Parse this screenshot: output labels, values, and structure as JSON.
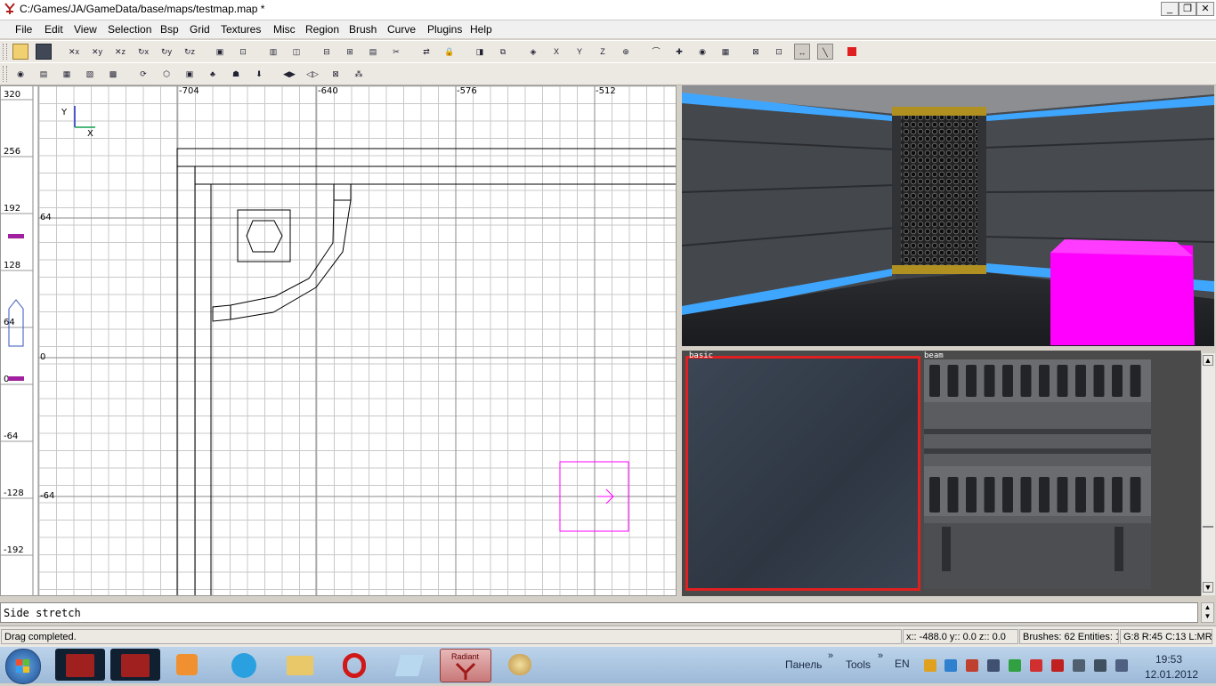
{
  "window": {
    "title": "C:/Games/JA/GameData/base/maps/testmap.map *",
    "minimize_glyph": "_",
    "maximize_glyph": "❐",
    "close_glyph": "✕"
  },
  "menu": [
    "File",
    "Edit",
    "View",
    "Selection",
    "Bsp",
    "Grid",
    "Textures",
    "Misc",
    "Region",
    "Brush",
    "Curve",
    "Plugins",
    "Help"
  ],
  "toolbar1_icons": [
    "open-icon",
    "save-icon",
    "flip-x-icon",
    "flip-y-icon",
    "flip-z-icon",
    "rotate-x-icon",
    "rotate-y-icon",
    "rotate-z-icon",
    "select-complete-tall-icon",
    "select-touching-icon",
    "select-partial-tall-icon",
    "select-inside-icon",
    "csg-subtract-icon",
    "csg-merge-icon",
    "hollow-icon",
    "clipper-icon",
    "change-views-icon",
    "texture-lock-icon",
    "camera-preview-icon",
    "cubic-clip-icon",
    "view-entities-icon",
    "view-x-icon",
    "view-y-icon",
    "view-z-icon",
    "patch-tool-icon",
    "patch-bend-icon",
    "patch-weld-icon",
    "patch-drill-icon",
    "show-patches-icon",
    "dont-select-model-icon",
    "dont-select-curve-icon",
    "scale-icon",
    "vertex-edit-icon",
    "red-brush-icon"
  ],
  "toolbar1_labels": [
    "",
    "",
    "✕x",
    "✕y",
    "✕z",
    "↻x",
    "↻y",
    "↻z",
    "▣",
    "⊡",
    "▥",
    "◫",
    "⊟",
    "⊞",
    "▤",
    "✂",
    "⇄",
    "🔒",
    "◨",
    "⧉",
    "◈",
    "X",
    "Y",
    "Z",
    "⊕",
    "⌒",
    "✚",
    "◉",
    "▦",
    "⊠",
    "⊡",
    "↔",
    "╲",
    ""
  ],
  "toolbar2_icons": [
    "camera-icon",
    "texture-window-icon",
    "entity-window-icon",
    "console-window-icon",
    "brush-icon",
    "refresh-icon",
    "hexagon-icon",
    "paint-icon",
    "tree-icon",
    "creature-icon",
    "down-arrow-icon",
    "red-flip-icon",
    "red-mirror-icon",
    "crossed-box-icon",
    "group-icon"
  ],
  "toolbar2_labels": [
    "◉",
    "▤",
    "▦",
    "▧",
    "▩",
    "⟳",
    "⬡",
    "▣",
    "♣",
    "☗",
    "⬇",
    "◀▶",
    "◁▷",
    "⊠",
    "⁂"
  ],
  "grid": {
    "x_ticks": [
      "-704",
      "-640",
      "-576",
      "-512"
    ],
    "y_ruler": [
      "320",
      "256",
      "192",
      "128",
      "64",
      "0",
      "-64",
      "-128",
      "-192"
    ],
    "y_inner": [
      "64",
      "0",
      "-64"
    ],
    "axis_y": "Y",
    "axis_x": "X"
  },
  "texture_browser": {
    "tex1": "basic",
    "tex2": "beam"
  },
  "console": {
    "text": "Side stretch"
  },
  "status": {
    "message": "Drag completed.",
    "coords": "x:: -488.0  y:: 0.0  z:: 0.0",
    "counts": "Brushes: 62 Entities: 1",
    "grid": "G:8 R:45 C:13 L:MR"
  },
  "taskbar": {
    "apps": [
      "jedi-academy-app",
      "jedi-academy-mp-app",
      "media-player-app",
      "skype-app",
      "explorer-app",
      "opera-app",
      "notepad-app",
      "radiant-app",
      "paint-app"
    ],
    "radiant_label": "Radiant",
    "panel_label": "Панель",
    "tools_label": "Tools",
    "lang": "EN",
    "time": "19:53",
    "date": "12.01.2012"
  },
  "colors": {
    "selection_magenta": "#ff00ff",
    "texture_highlight": "#e02020",
    "grid_line": "#c8c8c8",
    "major_line": "#8a8a8a"
  }
}
